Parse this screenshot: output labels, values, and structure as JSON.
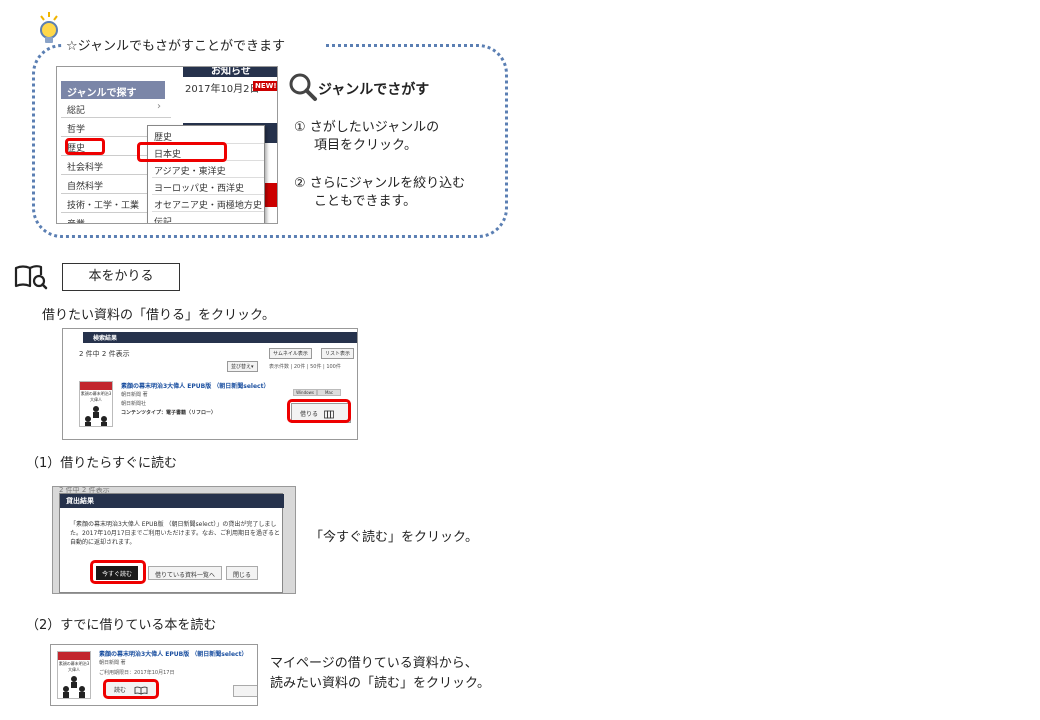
{
  "genre_tip": {
    "heading": "☆ジャンルでもさがすことができます",
    "title": "ジャンルでさがす",
    "step1_line1": "① さがしたいジャンルの",
    "step1_line2": "項目をクリック。",
    "step2_line1": "② さらにジャンルを絞り込む",
    "step2_line2": "こともできます。"
  },
  "genre_screenshot": {
    "news_title": "お知らせ",
    "news_date": "2017年10月2日",
    "new_badge": "NEW!",
    "sidebar_head": "ジャンルで探す",
    "sidebar_items": [
      "総記",
      "哲学",
      "歴史",
      "社会科学",
      "自然科学",
      "技術・工学・工業",
      "産業"
    ],
    "chevron": "›",
    "dropdown_items": [
      "歴史",
      "日本史",
      "アジア史・東洋史",
      "ヨーロッパ史・西洋史",
      "オセアニア史・両極地方史",
      "伝記"
    ]
  },
  "borrow": {
    "heading": "本をかりる",
    "instruction": "借りたい資料の「借りる」をクリック。"
  },
  "search_result_screenshot": {
    "tab": "検索結果",
    "count": "2 件中 2 件表示",
    "thumbnail_btn": "サムネイル表示",
    "list_btn": "リスト表示",
    "sort_btn": "並び替え▾",
    "per_page": "表示件数 | 20件 | 50件 | 100件",
    "book_title": "素顔の幕末明治3大偉人 EPUB版 （朝日新聞select）",
    "author": "朝日新聞 著",
    "publisher": "朝日新聞社",
    "content_type": "コンテンツタイプ：電子書籍（リフロー）",
    "os_labels": [
      "Windows",
      "Mac",
      "iOS",
      "Android"
    ],
    "borrow_btn": "借りる",
    "cover_title": "素顔の幕末明治3大偉人"
  },
  "read_now": {
    "subheading": "（1）借りたらすぐに読む",
    "note": "「今すぐ読む」をクリック。"
  },
  "loan_result_screenshot": {
    "bg_text": "2 件中 2 件表示",
    "modal_title": "貸出結果",
    "modal_body": "「素顔の幕末明治3大偉人 EPUB版 （朝日新聞select）」の貸出が完了しました。2017年10月17日までご利用いただけます。なお、ご利用期日を過ぎると自動的に返却されます。",
    "read_now_btn": "今すぐ読む",
    "loan_list_btn": "借りている資料一覧へ",
    "close_btn": "閉じる"
  },
  "read_borrowed": {
    "subheading": "（2）すでに借りている本を読む",
    "note_line1": "マイページの借りている資料から、",
    "note_line2": "読みたい資料の「読む」をクリック。"
  },
  "mypage_screenshot": {
    "book_title": "素顔の幕末明治3大偉人 EPUB版 （朝日新聞select）",
    "author": "朝日新聞 著",
    "due": "ご利用期限日：2017年10月17日",
    "read_btn": "読む",
    "cover_title": "素顔の幕末明治3大偉人"
  }
}
